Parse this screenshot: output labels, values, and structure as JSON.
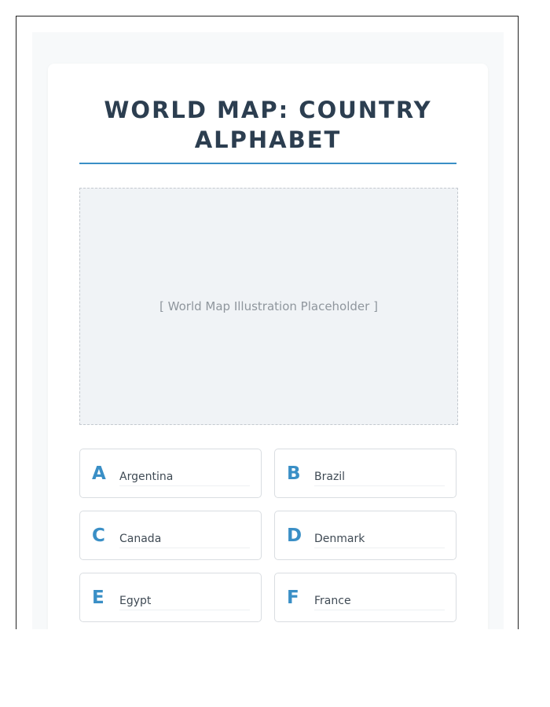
{
  "page": {
    "title": "World Map: Country Alphabet"
  },
  "map": {
    "placeholder_text": "[ World Map Illustration Placeholder ]"
  },
  "entries": [
    {
      "letter": "A",
      "country": "Argentina"
    },
    {
      "letter": "B",
      "country": "Brazil"
    },
    {
      "letter": "C",
      "country": "Canada"
    },
    {
      "letter": "D",
      "country": "Denmark"
    },
    {
      "letter": "E",
      "country": "Egypt"
    },
    {
      "letter": "F",
      "country": "France"
    }
  ],
  "colors": {
    "title": "#2c3e50",
    "accent": "#3a8fc6",
    "placeholder_bg": "#f0f3f6",
    "tile_border": "#d9dde1"
  }
}
